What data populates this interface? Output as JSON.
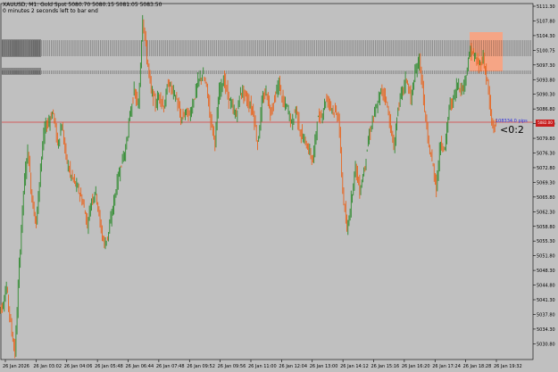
{
  "header": {
    "symbol_line": "XAUUSD, M1:  Gold Spot  5080.70 5080.15 5081.05 5083.50",
    "timer_line": "0 minutes 2 seconds left to bar end"
  },
  "indicator": {
    "pips_text": "108334.0 pips",
    "countdown_text": "<0:2",
    "current_price_tag": "5082.00"
  },
  "chart_data": {
    "type": "line",
    "title": "XAUUSD, M1",
    "ylim": [
      5027.5,
      5113.0
    ],
    "y_ticks": [
      "5111.30",
      "5107.80",
      "5104.30",
      "5100.75",
      "5097.30",
      "5093.80",
      "5090.30",
      "5086.80",
      "5083.30",
      "5079.80",
      "5076.30",
      "5072.80",
      "5069.30",
      "5065.80",
      "5062.30",
      "5058.80",
      "5055.30",
      "5051.80",
      "5048.30",
      "5044.80",
      "5041.30",
      "5037.80",
      "5034.30",
      "5030.80"
    ],
    "x_ticks": [
      "26 Jan 2026",
      "26 Jan 03:02",
      "26 Jan 04:06",
      "26 Jan 05:48",
      "26 Jan 06:44",
      "26 Jan 07:48",
      "26 Jan 09:52",
      "26 Jan 09:56",
      "26 Jan 11:00",
      "26 Jan 12:04",
      "26 Jan 13:00",
      "26 Jan 14:12",
      "26 Jan 15:16",
      "26 Jan 16:20",
      "26 Jan 17:24",
      "26 Jan 18:28",
      "26 Jan 19:32"
    ],
    "price_line": 5082.0,
    "series": [
      {
        "values": [
          5040,
          5045,
          5036,
          5029,
          5050,
          5068,
          5078,
          5066,
          5060,
          5074,
          5083,
          5085,
          5087,
          5079,
          5084,
          5076,
          5072,
          5070,
          5068,
          5065,
          5060,
          5066,
          5068,
          5060,
          5055,
          5058,
          5064,
          5070,
          5075,
          5078,
          5086,
          5092,
          5088,
          5110,
          5100,
          5092,
          5089,
          5091,
          5088,
          5094,
          5092,
          5090,
          5085,
          5087,
          5086,
          5090,
          5094,
          5096,
          5093,
          5085,
          5080,
          5092,
          5095,
          5091,
          5088,
          5086,
          5092,
          5091,
          5089,
          5087,
          5079,
          5089,
          5092,
          5087,
          5090,
          5094,
          5089,
          5088,
          5084,
          5088,
          5082,
          5080,
          5078,
          5075,
          5085,
          5086,
          5090,
          5089,
          5087,
          5086,
          5068,
          5058,
          5066,
          5074,
          5068,
          5073,
          5080,
          5085,
          5088,
          5092,
          5091,
          5085,
          5078,
          5088,
          5092,
          5095,
          5090,
          5096,
          5100,
          5090,
          5080,
          5075,
          5069,
          5080,
          5078,
          5088,
          5090,
          5094,
          5092,
          5096,
          5102,
          5100,
          5098,
          5100,
          5094,
          5084,
          5083
        ]
      }
    ]
  },
  "colors": {
    "background": "#c0c0c0",
    "bull_candle": "#2e8b2e",
    "bear_candle": "#e8641e",
    "price_line": "#d83c3c",
    "level_lines": "#000000",
    "highlight_zone": "#ffa07a"
  }
}
